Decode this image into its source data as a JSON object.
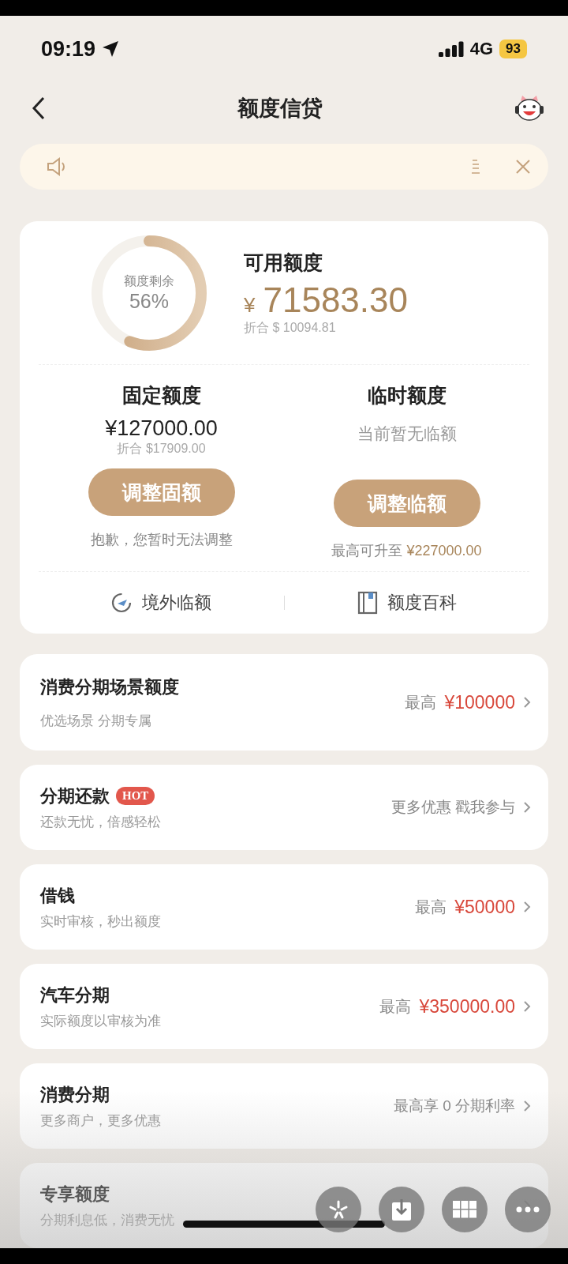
{
  "status_bar": {
    "time": "09:19",
    "network": "4G",
    "battery": "93"
  },
  "nav": {
    "title": "额度信贷"
  },
  "notice": {
    "closable": true
  },
  "summary": {
    "ring_label": "额度剩余",
    "ring_percent": "56%",
    "title": "可用额度",
    "currency": "¥",
    "amount": "71583.30",
    "converted": "折合 $ 10094.81"
  },
  "quotas": [
    {
      "title": "固定额度",
      "amount": "¥127000.00",
      "converted": "折合 $17909.00",
      "button": "调整固额",
      "note": "抱歉，您暂时无法调整"
    },
    {
      "title": "临时额度",
      "empty_text": "当前暂无临额",
      "button": "调整临额",
      "note": "最高可升至 **¥227000.00**"
    }
  ],
  "links": [
    {
      "kind": "plane",
      "label": "境外临额"
    },
    {
      "kind": "book",
      "label": "额度百科"
    }
  ],
  "items": [
    {
      "kind": "amount",
      "title": "消费分期场景额度",
      "subtitle": "优选场景 分期专属",
      "prefix": "最高",
      "value": "¥100000"
    },
    {
      "kind": "text",
      "title": "分期还款",
      "badge": "HOT",
      "subtitle": "还款无忧，倍感轻松",
      "text": "更多优惠 戳我参与"
    },
    {
      "kind": "amount",
      "title": "借钱",
      "subtitle": "实时审核，秒出额度",
      "prefix": "最高",
      "value": "¥50000"
    },
    {
      "kind": "amount",
      "title": "汽车分期",
      "subtitle": "实际额度以审核为准",
      "prefix": "最高",
      "value": "¥350000.00"
    },
    {
      "kind": "text",
      "title": "消费分期",
      "subtitle": "更多商户，更多优惠",
      "text": "最高享 0 分期利率"
    },
    {
      "kind": "text",
      "title": "专享额度",
      "subtitle": "分期利息低，消费无忧"
    }
  ],
  "floating_buttons": [
    {
      "kind": "spark"
    },
    {
      "kind": "download"
    },
    {
      "kind": "grid"
    },
    {
      "kind": "more"
    }
  ]
}
